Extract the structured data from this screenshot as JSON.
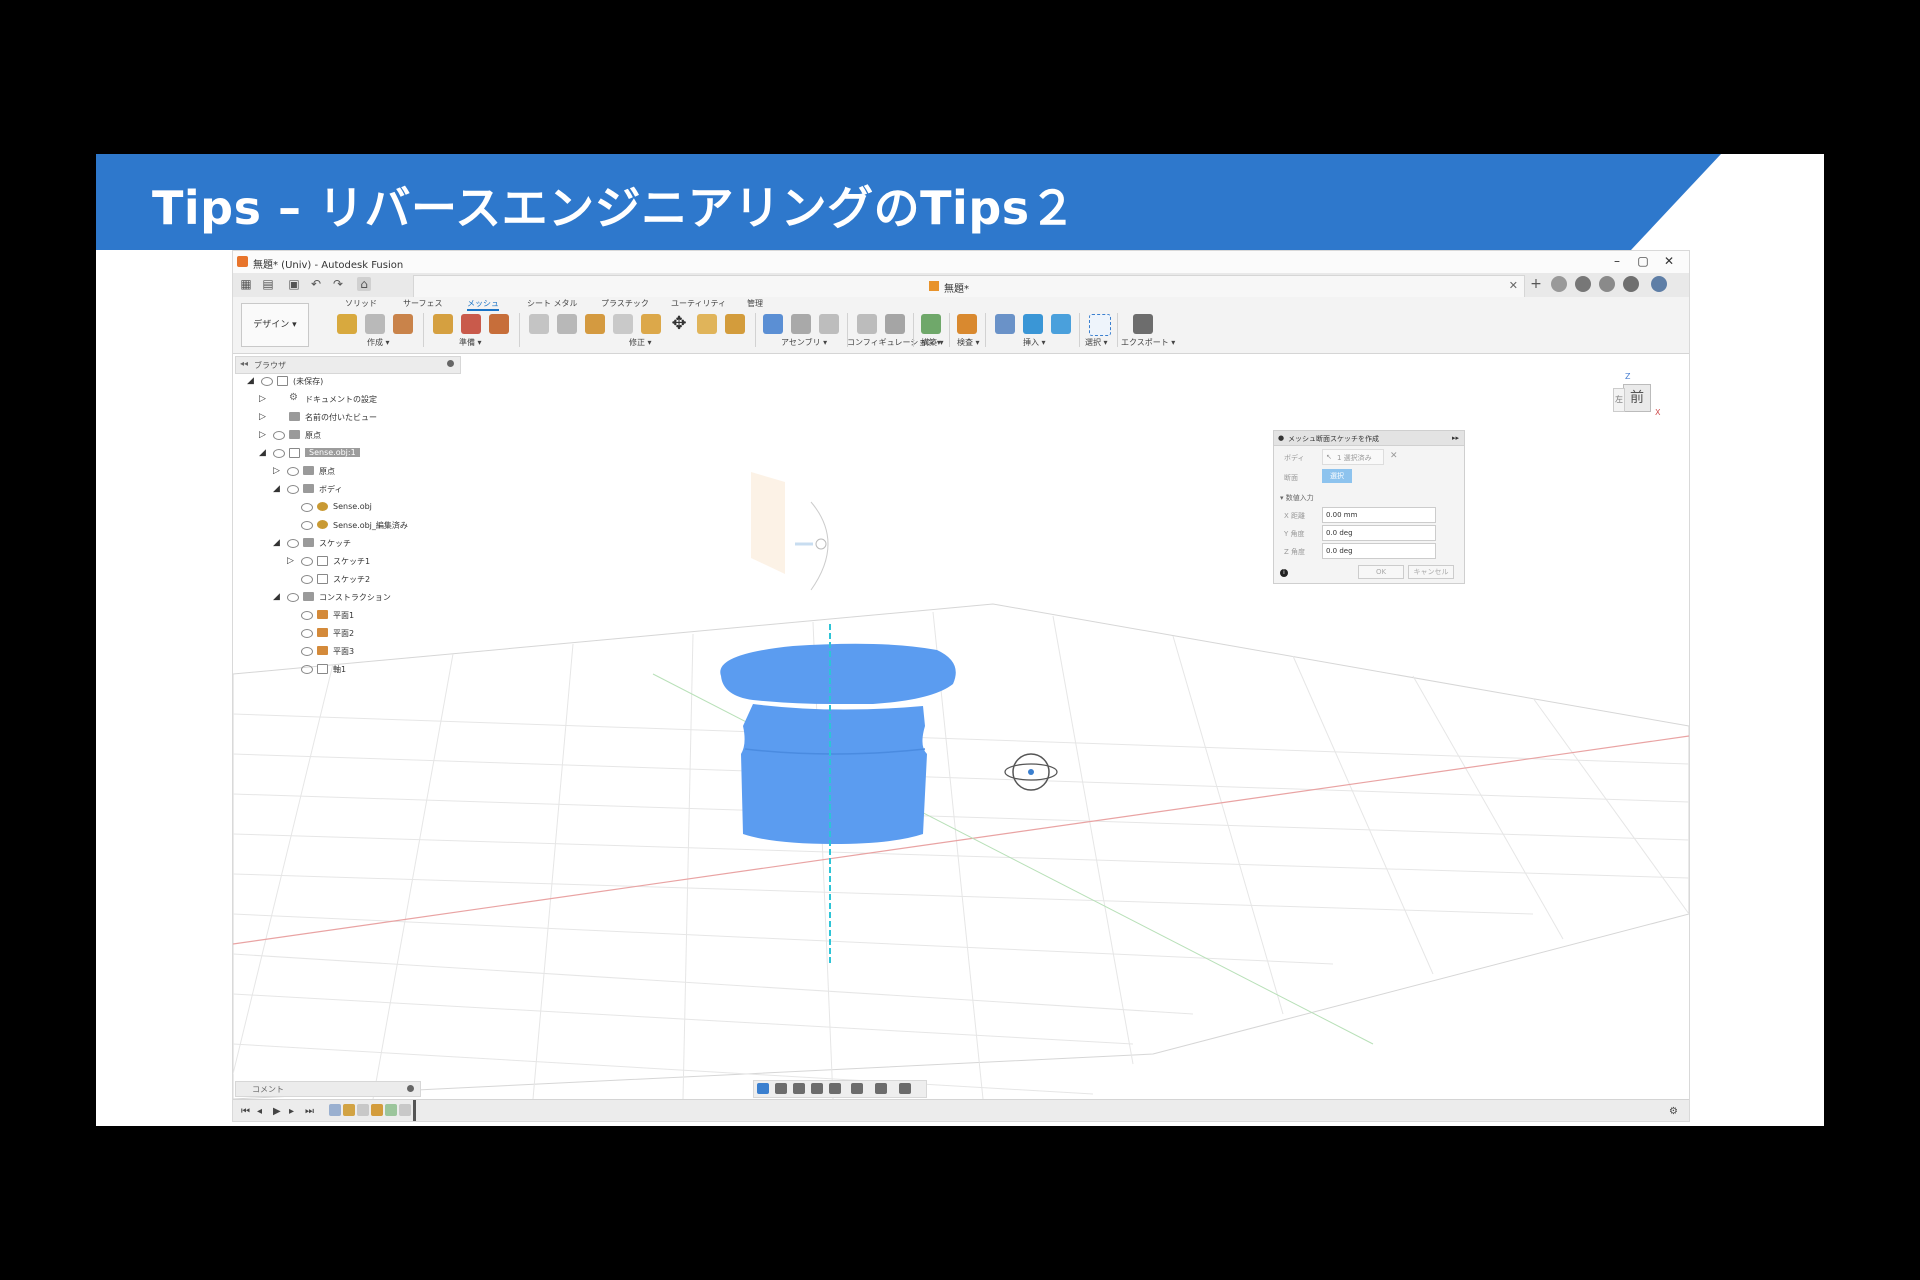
{
  "slide": {
    "title": "Tips – リバースエンジニアリングのTips２",
    "accent": "#2e78cc"
  },
  "window": {
    "title": "無題* (Univ) - Autodesk Fusion",
    "controls": [
      "–",
      "▢",
      "✕"
    ]
  },
  "document_tab": {
    "title": "無題*"
  },
  "ribbon": {
    "workspace": "デザイン ▾",
    "tabs": [
      "ソリッド",
      "サーフェス",
      "メッシュ",
      "シート メタル",
      "プラスチック",
      "ユーティリティ",
      "管理"
    ],
    "active_tab": "メッシュ",
    "groups": [
      "作成 ▾",
      "準備 ▾",
      "修正 ▾",
      "アセンブリ ▾",
      "コンフィギュレーション ▾",
      "構築 ▾",
      "検査 ▾",
      "挿入 ▾",
      "選択 ▾",
      "エクスポート ▾"
    ]
  },
  "browser": {
    "title": "ブラウザ",
    "items": [
      {
        "label": "(未保存)"
      },
      {
        "label": "ドキュメントの設定"
      },
      {
        "label": "名前の付いたビュー"
      },
      {
        "label": "原点"
      },
      {
        "label": "Sense.obj:1"
      },
      {
        "label": "原点"
      },
      {
        "label": "ボディ"
      },
      {
        "label": "Sense.obj"
      },
      {
        "label": "Sense.obj_編集済み"
      },
      {
        "label": "スケッチ"
      },
      {
        "label": "スケッチ1"
      },
      {
        "label": "スケッチ2"
      },
      {
        "label": "コンストラクション"
      },
      {
        "label": "平面1"
      },
      {
        "label": "平面2"
      },
      {
        "label": "平面3"
      },
      {
        "label": "軸1"
      }
    ]
  },
  "viewcube": {
    "front": "前",
    "left": "左",
    "axis_z": "Z",
    "axis_x": "X"
  },
  "dialog": {
    "title": "メッシュ断面スケッチを作成",
    "body_label": "ボディ",
    "body_value": "1 選択済み",
    "section_label": "断面",
    "section_value": "選択",
    "numeric_label": "数値入力",
    "fields": [
      {
        "label": "X 距離",
        "value": "0.00 mm"
      },
      {
        "label": "Y 角度",
        "value": "0.0 deg"
      },
      {
        "label": "Z 角度",
        "value": "0.0 deg"
      }
    ],
    "ok": "OK",
    "cancel": "キャンセル"
  },
  "comments": {
    "label": "コメント"
  },
  "colors": {
    "mesh": "#5b9cf0",
    "axis": "#2ec4d6",
    "grid": "#e4e4e4"
  }
}
